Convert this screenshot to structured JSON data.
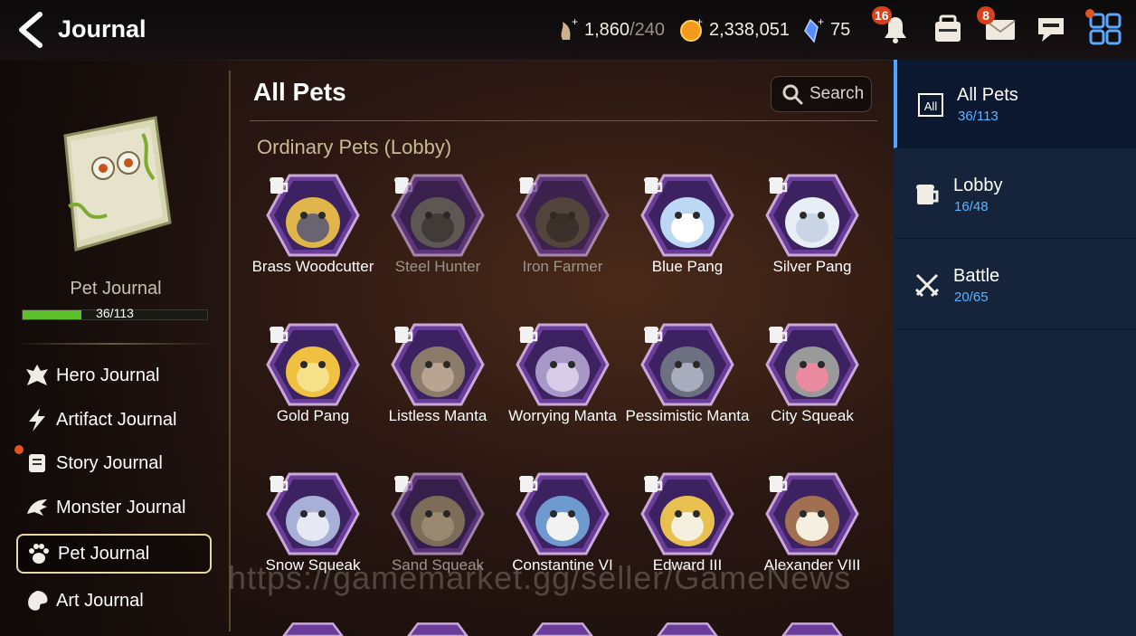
{
  "header": {
    "title": "Journal",
    "stamina": {
      "value": "1,860",
      "max": "/240"
    },
    "gold": "2,338,051",
    "crystals": "75",
    "notifications_badge": "16",
    "mail_badge": "8"
  },
  "left": {
    "book_label": "Pet Journal",
    "progress_text": "36/113",
    "progress_fraction": 0.3186,
    "menu": [
      {
        "label": "Hero Journal",
        "icon": "hero-icon"
      },
      {
        "label": "Artifact Journal",
        "icon": "lightning-icon"
      },
      {
        "label": "Story Journal",
        "icon": "scroll-icon"
      },
      {
        "label": "Monster Journal",
        "icon": "dragon-icon"
      },
      {
        "label": "Pet Journal",
        "icon": "paw-icon"
      },
      {
        "label": "Art Journal",
        "icon": "palette-icon"
      }
    ]
  },
  "main": {
    "title": "All Pets",
    "search_label": "Search",
    "section_title": "Ordinary Pets (Lobby)",
    "pets": [
      {
        "name": "Brass Woodcutter",
        "owned": true
      },
      {
        "name": "Steel Hunter",
        "owned": false
      },
      {
        "name": "Iron Farmer",
        "owned": false
      },
      {
        "name": "Blue Pang",
        "owned": true
      },
      {
        "name": "Silver Pang",
        "owned": true
      },
      {
        "name": "Gold Pang",
        "owned": true
      },
      {
        "name": "Listless Manta",
        "owned": true
      },
      {
        "name": "Worrying Manta",
        "owned": true
      },
      {
        "name": "Pessimistic Manta",
        "owned": true
      },
      {
        "name": "City Squeak",
        "owned": true
      },
      {
        "name": "Snow Squeak",
        "owned": true
      },
      {
        "name": "Sand Squeak",
        "owned": false
      },
      {
        "name": "Constantine VI",
        "owned": true
      },
      {
        "name": "Edward III",
        "owned": true
      },
      {
        "name": "Alexander VIII",
        "owned": true
      }
    ]
  },
  "right": {
    "tabs": [
      {
        "icon_text": "All",
        "label": "All Pets",
        "count": "36/113"
      },
      {
        "icon_text": "",
        "label": "Lobby",
        "count": "16/48"
      },
      {
        "icon_text": "",
        "label": "Battle",
        "count": "20/65"
      }
    ]
  },
  "watermark": "https://gamemarket.gg/seller/GameNews",
  "colors": {
    "accent": "#4ea5ff",
    "progress": "#5fbe2b",
    "badge": "#d7401b",
    "section": "#cdb895"
  }
}
